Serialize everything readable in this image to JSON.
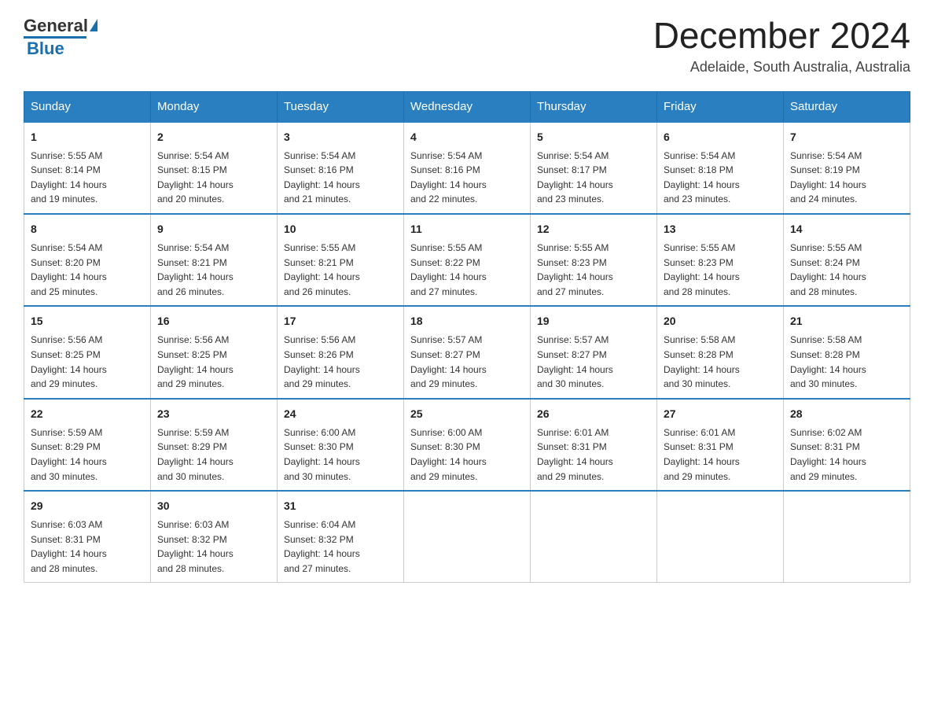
{
  "header": {
    "logo_general": "General",
    "logo_blue": "Blue",
    "month_title": "December 2024",
    "location": "Adelaide, South Australia, Australia"
  },
  "days_of_week": [
    "Sunday",
    "Monday",
    "Tuesday",
    "Wednesday",
    "Thursday",
    "Friday",
    "Saturday"
  ],
  "weeks": [
    [
      {
        "day": "1",
        "sunrise": "5:55 AM",
        "sunset": "8:14 PM",
        "daylight": "14 hours and 19 minutes."
      },
      {
        "day": "2",
        "sunrise": "5:54 AM",
        "sunset": "8:15 PM",
        "daylight": "14 hours and 20 minutes."
      },
      {
        "day": "3",
        "sunrise": "5:54 AM",
        "sunset": "8:16 PM",
        "daylight": "14 hours and 21 minutes."
      },
      {
        "day": "4",
        "sunrise": "5:54 AM",
        "sunset": "8:16 PM",
        "daylight": "14 hours and 22 minutes."
      },
      {
        "day": "5",
        "sunrise": "5:54 AM",
        "sunset": "8:17 PM",
        "daylight": "14 hours and 23 minutes."
      },
      {
        "day": "6",
        "sunrise": "5:54 AM",
        "sunset": "8:18 PM",
        "daylight": "14 hours and 23 minutes."
      },
      {
        "day": "7",
        "sunrise": "5:54 AM",
        "sunset": "8:19 PM",
        "daylight": "14 hours and 24 minutes."
      }
    ],
    [
      {
        "day": "8",
        "sunrise": "5:54 AM",
        "sunset": "8:20 PM",
        "daylight": "14 hours and 25 minutes."
      },
      {
        "day": "9",
        "sunrise": "5:54 AM",
        "sunset": "8:21 PM",
        "daylight": "14 hours and 26 minutes."
      },
      {
        "day": "10",
        "sunrise": "5:55 AM",
        "sunset": "8:21 PM",
        "daylight": "14 hours and 26 minutes."
      },
      {
        "day": "11",
        "sunrise": "5:55 AM",
        "sunset": "8:22 PM",
        "daylight": "14 hours and 27 minutes."
      },
      {
        "day": "12",
        "sunrise": "5:55 AM",
        "sunset": "8:23 PM",
        "daylight": "14 hours and 27 minutes."
      },
      {
        "day": "13",
        "sunrise": "5:55 AM",
        "sunset": "8:23 PM",
        "daylight": "14 hours and 28 minutes."
      },
      {
        "day": "14",
        "sunrise": "5:55 AM",
        "sunset": "8:24 PM",
        "daylight": "14 hours and 28 minutes."
      }
    ],
    [
      {
        "day": "15",
        "sunrise": "5:56 AM",
        "sunset": "8:25 PM",
        "daylight": "14 hours and 29 minutes."
      },
      {
        "day": "16",
        "sunrise": "5:56 AM",
        "sunset": "8:25 PM",
        "daylight": "14 hours and 29 minutes."
      },
      {
        "day": "17",
        "sunrise": "5:56 AM",
        "sunset": "8:26 PM",
        "daylight": "14 hours and 29 minutes."
      },
      {
        "day": "18",
        "sunrise": "5:57 AM",
        "sunset": "8:27 PM",
        "daylight": "14 hours and 29 minutes."
      },
      {
        "day": "19",
        "sunrise": "5:57 AM",
        "sunset": "8:27 PM",
        "daylight": "14 hours and 30 minutes."
      },
      {
        "day": "20",
        "sunrise": "5:58 AM",
        "sunset": "8:28 PM",
        "daylight": "14 hours and 30 minutes."
      },
      {
        "day": "21",
        "sunrise": "5:58 AM",
        "sunset": "8:28 PM",
        "daylight": "14 hours and 30 minutes."
      }
    ],
    [
      {
        "day": "22",
        "sunrise": "5:59 AM",
        "sunset": "8:29 PM",
        "daylight": "14 hours and 30 minutes."
      },
      {
        "day": "23",
        "sunrise": "5:59 AM",
        "sunset": "8:29 PM",
        "daylight": "14 hours and 30 minutes."
      },
      {
        "day": "24",
        "sunrise": "6:00 AM",
        "sunset": "8:30 PM",
        "daylight": "14 hours and 30 minutes."
      },
      {
        "day": "25",
        "sunrise": "6:00 AM",
        "sunset": "8:30 PM",
        "daylight": "14 hours and 29 minutes."
      },
      {
        "day": "26",
        "sunrise": "6:01 AM",
        "sunset": "8:31 PM",
        "daylight": "14 hours and 29 minutes."
      },
      {
        "day": "27",
        "sunrise": "6:01 AM",
        "sunset": "8:31 PM",
        "daylight": "14 hours and 29 minutes."
      },
      {
        "day": "28",
        "sunrise": "6:02 AM",
        "sunset": "8:31 PM",
        "daylight": "14 hours and 29 minutes."
      }
    ],
    [
      {
        "day": "29",
        "sunrise": "6:03 AM",
        "sunset": "8:31 PM",
        "daylight": "14 hours and 28 minutes."
      },
      {
        "day": "30",
        "sunrise": "6:03 AM",
        "sunset": "8:32 PM",
        "daylight": "14 hours and 28 minutes."
      },
      {
        "day": "31",
        "sunrise": "6:04 AM",
        "sunset": "8:32 PM",
        "daylight": "14 hours and 27 minutes."
      },
      null,
      null,
      null,
      null
    ]
  ],
  "labels": {
    "sunrise": "Sunrise:",
    "sunset": "Sunset:",
    "daylight": "Daylight:"
  }
}
